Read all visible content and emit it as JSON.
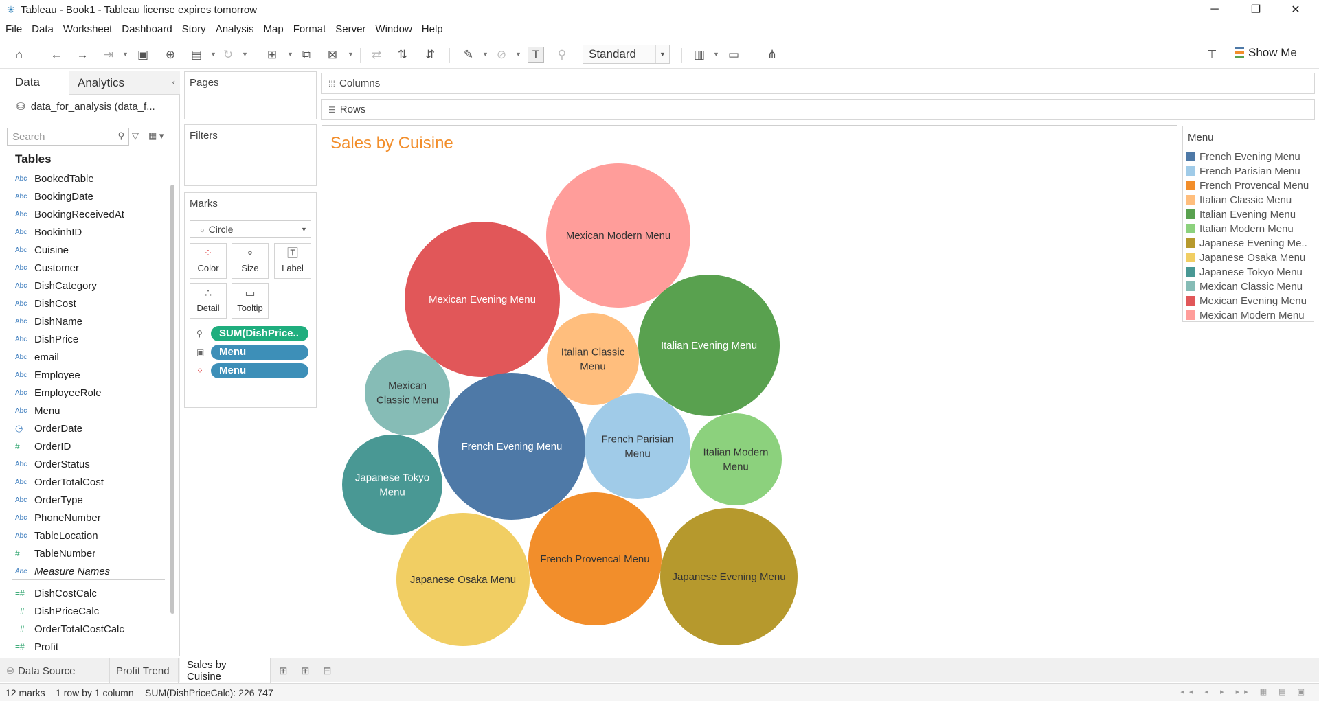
{
  "window": {
    "title": "Tableau - Book1 - Tableau license expires tomorrow",
    "minimize": "─",
    "restore": "❐",
    "close": "✕"
  },
  "menu": [
    "File",
    "Data",
    "Worksheet",
    "Dashboard",
    "Story",
    "Analysis",
    "Map",
    "Format",
    "Server",
    "Window",
    "Help"
  ],
  "toolbar": {
    "fit_select": "Standard",
    "show_me": "Show Me"
  },
  "data_pane": {
    "tab_data": "Data",
    "tab_analytics": "Analytics",
    "datasource": "data_for_analysis (data_f...",
    "search_placeholder": "Search",
    "tables_header": "Tables",
    "fields": [
      {
        "name": "BookedTable",
        "type": "Abc"
      },
      {
        "name": "BookingDate",
        "type": "Abc"
      },
      {
        "name": "BookingReceivedAt",
        "type": "Abc"
      },
      {
        "name": "BookinhID",
        "type": "Abc"
      },
      {
        "name": "Cuisine",
        "type": "Abc"
      },
      {
        "name": "Customer",
        "type": "Abc"
      },
      {
        "name": "DishCategory",
        "type": "Abc"
      },
      {
        "name": "DishCost",
        "type": "Abc"
      },
      {
        "name": "DishName",
        "type": "Abc"
      },
      {
        "name": "DishPrice",
        "type": "Abc"
      },
      {
        "name": "email",
        "type": "Abc"
      },
      {
        "name": "Employee",
        "type": "Abc"
      },
      {
        "name": "EmployeeRole",
        "type": "Abc"
      },
      {
        "name": "Menu",
        "type": "Abc"
      },
      {
        "name": "OrderDate",
        "type": "date"
      },
      {
        "name": "OrderID",
        "type": "#"
      },
      {
        "name": "OrderStatus",
        "type": "Abc"
      },
      {
        "name": "OrderTotalCost",
        "type": "Abc"
      },
      {
        "name": "OrderType",
        "type": "Abc"
      },
      {
        "name": "PhoneNumber",
        "type": "Abc"
      },
      {
        "name": "TableLocation",
        "type": "Abc"
      },
      {
        "name": "TableNumber",
        "type": "#"
      },
      {
        "name": "Measure Names",
        "type": "Abc"
      }
    ],
    "calc_fields": [
      "DishCostCalc",
      "DishPriceCalc",
      "OrderTotalCostCalc",
      "Profit"
    ]
  },
  "shelves": {
    "pages": "Pages",
    "filters": "Filters",
    "marks": "Marks",
    "mark_type": "Circle",
    "columns": "Columns",
    "rows": "Rows",
    "mark_buttons": [
      "Color",
      "Size",
      "Label",
      "Detail",
      "Tooltip"
    ],
    "pills": [
      {
        "label": "SUM(DishPrice..",
        "color": "#1fae7e",
        "icon": "size"
      },
      {
        "label": "Menu",
        "color": "#3d8fb8",
        "icon": "label"
      },
      {
        "label": "Menu",
        "color": "#3d8fb8",
        "icon": "color"
      }
    ]
  },
  "viz": {
    "title": "Sales by Cuisine"
  },
  "legend": {
    "title": "Menu",
    "items": [
      {
        "label": "French Evening Menu",
        "color": "#4e79a7"
      },
      {
        "label": "French Parisian Menu",
        "color": "#a0cbe8"
      },
      {
        "label": "French Provencal Menu",
        "color": "#f28e2b"
      },
      {
        "label": "Italian Classic Menu",
        "color": "#ffbe7d"
      },
      {
        "label": "Italian Evening Menu",
        "color": "#59a14f"
      },
      {
        "label": "Italian Modern Menu",
        "color": "#8cd17d"
      },
      {
        "label": "Japanese Evening Me..",
        "color": "#b6992d"
      },
      {
        "label": "Japanese Osaka Menu",
        "color": "#f1ce63"
      },
      {
        "label": "Japanese Tokyo Menu",
        "color": "#499894"
      },
      {
        "label": "Mexican Classic Menu",
        "color": "#86bcb6"
      },
      {
        "label": "Mexican Evening Menu",
        "color": "#e15759"
      },
      {
        "label": "Mexican Modern Menu",
        "color": "#ff9d9a"
      }
    ]
  },
  "chart_data": {
    "type": "packed-bubble",
    "title": "Sales by Cuisine",
    "size_measure": "SUM(DishPriceCalc)",
    "bubbles": [
      {
        "label": "Mexican Modern Menu",
        "lines": [
          "Mexican Modern Menu"
        ],
        "color": "#ff9d9a",
        "text_color": "#333333"
      },
      {
        "label": "Mexican Evening Menu",
        "lines": [
          "Mexican Evening Menu"
        ],
        "color": "#e15759",
        "text_color": "#ffffff"
      },
      {
        "label": "Italian Classic Menu",
        "lines": [
          "Italian Classic",
          "Menu"
        ],
        "color": "#ffbe7d",
        "text_color": "#333333"
      },
      {
        "label": "Italian Evening Menu",
        "lines": [
          "Italian Evening Menu"
        ],
        "color": "#59a14f",
        "text_color": "#ffffff"
      },
      {
        "label": "Mexican Classic Menu",
        "lines": [
          "Mexican",
          "Classic Menu"
        ],
        "color": "#86bcb6",
        "text_color": "#333333"
      },
      {
        "label": "French Evening Menu",
        "lines": [
          "French Evening Menu"
        ],
        "color": "#4e79a7",
        "text_color": "#ffffff"
      },
      {
        "label": "French Parisian Menu",
        "lines": [
          "French Parisian",
          "Menu"
        ],
        "color": "#a0cbe8",
        "text_color": "#333333"
      },
      {
        "label": "Italian Modern Menu",
        "lines": [
          "Italian Modern",
          "Menu"
        ],
        "color": "#8cd17d",
        "text_color": "#333333"
      },
      {
        "label": "Japanese Tokyo Menu",
        "lines": [
          "Japanese Tokyo",
          "Menu"
        ],
        "color": "#499894",
        "text_color": "#ffffff"
      },
      {
        "label": "Japanese Osaka Menu",
        "lines": [
          "Japanese Osaka Menu"
        ],
        "color": "#f1ce63",
        "text_color": "#333333"
      },
      {
        "label": "French Provencal Menu",
        "lines": [
          "French Provencal Menu"
        ],
        "color": "#f28e2b",
        "text_color": "#333333"
      },
      {
        "label": "Japanese Evening Menu",
        "lines": [
          "Japanese Evening Menu"
        ],
        "color": "#b6992d",
        "text_color": "#333333"
      }
    ]
  },
  "sheets": {
    "data_source": "Data Source",
    "tabs": [
      "Profit Trend",
      "Sales by Cuisine"
    ],
    "active": "Sales by Cuisine"
  },
  "status": {
    "marks": "12 marks",
    "dims": "1 row by 1 column",
    "sum": "SUM(DishPriceCalc): 226 747"
  }
}
